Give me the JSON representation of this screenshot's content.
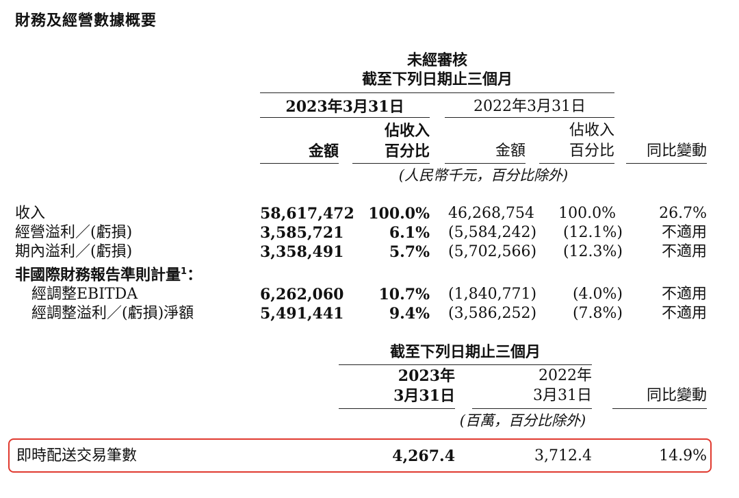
{
  "title": "財務及經營數據概要",
  "table1": {
    "header_unaudited": "未經審核",
    "header_period": "截至下列日期止三個月",
    "col_2023": "2023年3月31日",
    "col_2022": "2022年3月31日",
    "sub_amount": "金額",
    "sub_pct_line1": "佔收入",
    "sub_pct_line2": "百分比",
    "sub_yoy": "同比變動",
    "unit_note": "(人民幣千元，百分比除外)",
    "rows": [
      {
        "label": "收入",
        "a2023": "58,617,472",
        "p2023": "100.0%",
        "a2022": "46,268,754",
        "p2022": "100.0%",
        "yoy": "26.7%"
      },
      {
        "label": "經營溢利／(虧損)",
        "a2023": "3,585,721",
        "p2023": "6.1%",
        "a2022": "(5,584,242)",
        "p2022": "(12.1%)",
        "yoy": "不適用"
      },
      {
        "label": "期內溢利／(虧損)",
        "a2023": "3,358,491",
        "p2023": "5.7%",
        "a2022": "(5,702,566)",
        "p2022": "(12.3%)",
        "yoy": "不適用"
      }
    ],
    "nongaap_heading": "非國際財務報告準則計量",
    "nongaap_footnote": "1",
    "nongaap_colon": "：",
    "nongaap_rows": [
      {
        "label": "經調整EBITDA",
        "a2023": "6,262,060",
        "p2023": "10.7%",
        "a2022": "(1,840,771)",
        "p2022": "(4.0%)",
        "yoy": "不適用"
      },
      {
        "label": "經調整溢利／(虧損)淨額",
        "a2023": "5,491,441",
        "p2023": "9.4%",
        "a2022": "(3,586,252)",
        "p2022": "(7.8%)",
        "yoy": "不適用"
      }
    ]
  },
  "table2": {
    "header_period": "截至下列日期止三個月",
    "col_2023_line1": "2023年",
    "col_2023_line2": "3月31日",
    "col_2022_line1": "2022年",
    "col_2022_line2": "3月31日",
    "col_yoy": "同比變動",
    "unit_note": "(百萬，百分比除外)",
    "row": {
      "label": "即時配送交易筆數",
      "v2023": "4,267.4",
      "v2022": "3,712.4",
      "yoy": "14.9%"
    }
  },
  "colors": {
    "highlight_border": "#e0392e"
  }
}
